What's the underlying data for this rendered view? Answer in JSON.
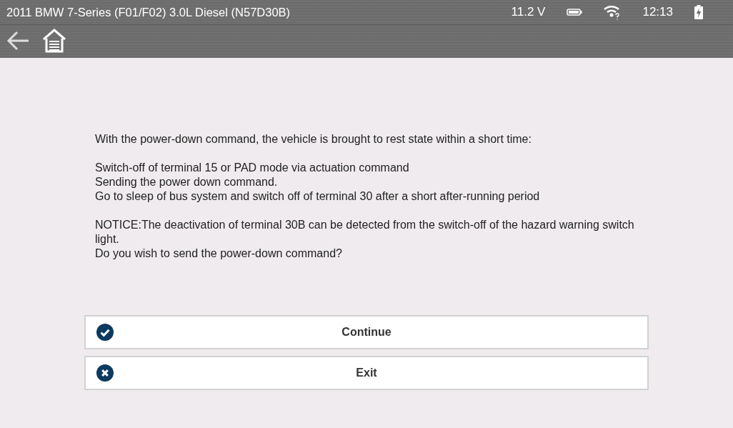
{
  "status_bar": {
    "title": "2011 BMW 7-Series (F01/F02) 3.0L Diesel (N57D30B)",
    "voltage": "11.2 V",
    "time": "12:13"
  },
  "message": [
    [
      "With the power-down command, the vehicle is brought to rest state within a short time:"
    ],
    [
      "Switch-off of terminal 15 or PAD mode via actuation command",
      "Sending the power down command.",
      "Go to sleep of bus system and switch off of terminal 30 after a short after-running period"
    ],
    [
      "NOTICE:The deactivation of terminal 30B can be detected from the switch-off of the hazard warning switch light.",
      "Do you wish to send the power-down command?"
    ]
  ],
  "buttons": [
    {
      "label": "Continue",
      "kind": "check"
    },
    {
      "label": "Exit",
      "kind": "cross"
    }
  ]
}
